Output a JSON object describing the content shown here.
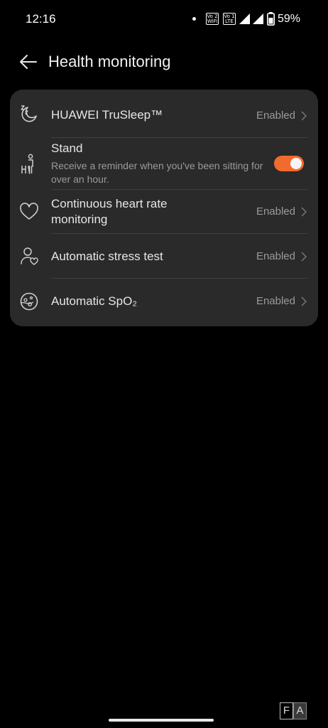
{
  "status_bar": {
    "time": "12:16",
    "sim1_line1": "Vo 2",
    "sim1_line2": "WiFi",
    "sim2_line1": "Vo 1",
    "sim2_line2": "LTE",
    "battery": "59%"
  },
  "header": {
    "title": "Health monitoring"
  },
  "items": [
    {
      "title": "HUAWEI TruSleep™",
      "value": "Enabled",
      "icon": "sleep-moon-icon"
    },
    {
      "title": "Stand",
      "description": "Receive a reminder when you've been sitting for over an hour.",
      "toggle_on": true,
      "icon": "stand-person-icon"
    },
    {
      "title": "Continuous heart rate monitoring",
      "value": "Enabled",
      "icon": "heart-icon"
    },
    {
      "title": "Automatic stress test",
      "value": "Enabled",
      "icon": "stress-person-heart-icon"
    },
    {
      "title": "Automatic SpO₂",
      "value": "Enabled",
      "icon": "spo2-icon"
    }
  ],
  "colors": {
    "background": "#000000",
    "card": "#2a2a2a",
    "accent": "#f26b2e",
    "secondary_text": "#9a9a9a"
  },
  "watermark": {
    "left": "F",
    "right": "A"
  }
}
